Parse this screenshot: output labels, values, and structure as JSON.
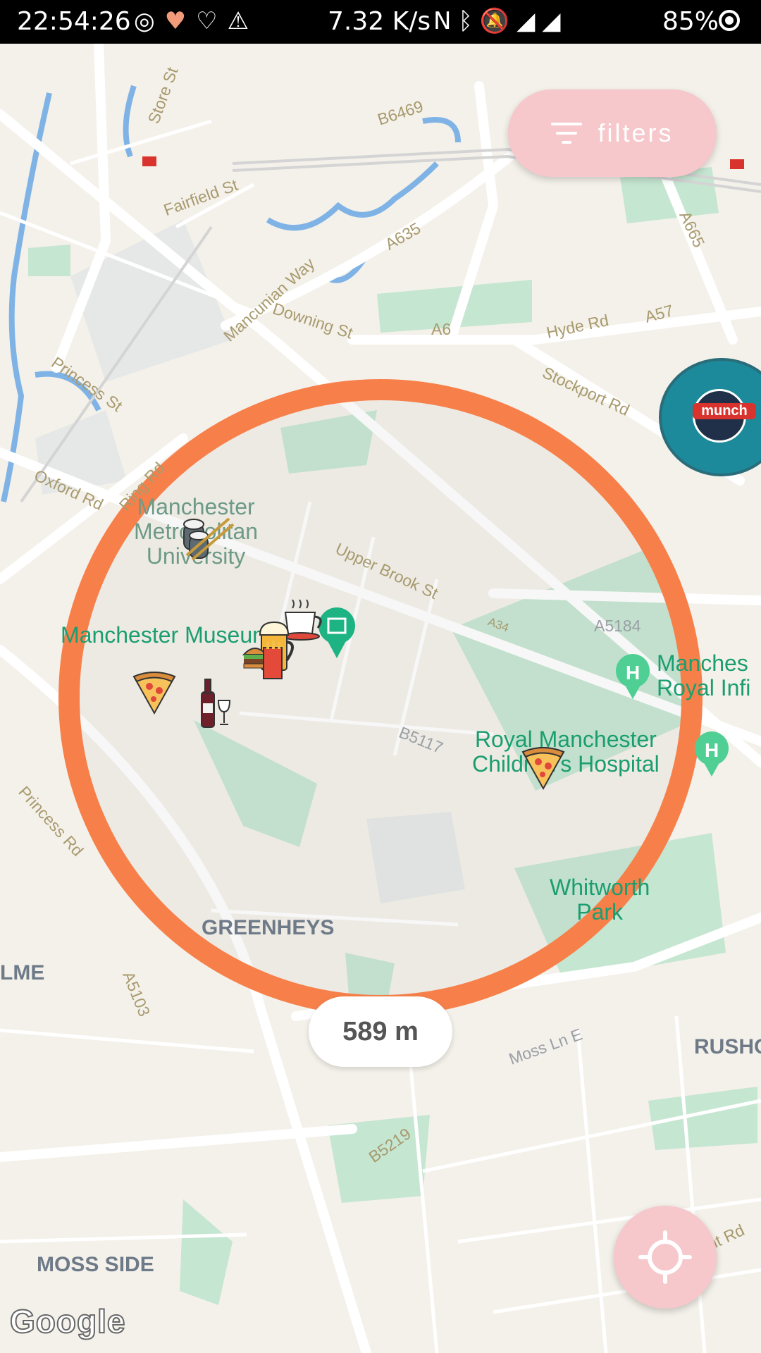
{
  "status_bar": {
    "time": "22:54:26",
    "speed": "7.32 K/s",
    "battery": "85%",
    "left_icons": [
      "instagram-icon",
      "heart-rate-icon",
      "health-icon",
      "warning-icon"
    ],
    "right_icons": [
      "nfc-icon",
      "bluetooth-icon",
      "mute-icon",
      "wifi-icon",
      "signal-icon",
      "signal-icon"
    ]
  },
  "toolbar": {
    "filters_label": "filters"
  },
  "radius": {
    "value": "589 m"
  },
  "map": {
    "road_labels": [
      "Store St",
      "B6469",
      "Fairfield St",
      "A635",
      "Mancunian Way",
      "Downing St",
      "A6",
      "Hyde Rd",
      "A57",
      "A665",
      "Stockport Rd",
      "Princess St",
      "Oxford Rd",
      "Ring Rd",
      "Upper Brook St",
      "A34",
      "A5184",
      "B5117",
      "Princess Rd",
      "A5103",
      "Moss Ln E",
      "B5219",
      "emont Rd"
    ],
    "place_labels": {
      "university": "Manchester\nMetropolitan\nUniversity",
      "museum": "Manchester Museum",
      "infirmary": "Manches\nRoyal Infi",
      "hospital": "Royal Manchester\nChildren's Hospital",
      "park": "Whitworth\nPark"
    },
    "area_labels": [
      "GREENHEYS",
      "LME",
      "RUSHO",
      "MOSS SIDE"
    ],
    "google_logo": "Google"
  },
  "avatar": {
    "text": "munch"
  },
  "colors": {
    "circle": "#f7804a",
    "filters_bg": "#f6c7cb",
    "locate_bg": "#f6c7cb",
    "place_text": "#1a9e6f"
  }
}
